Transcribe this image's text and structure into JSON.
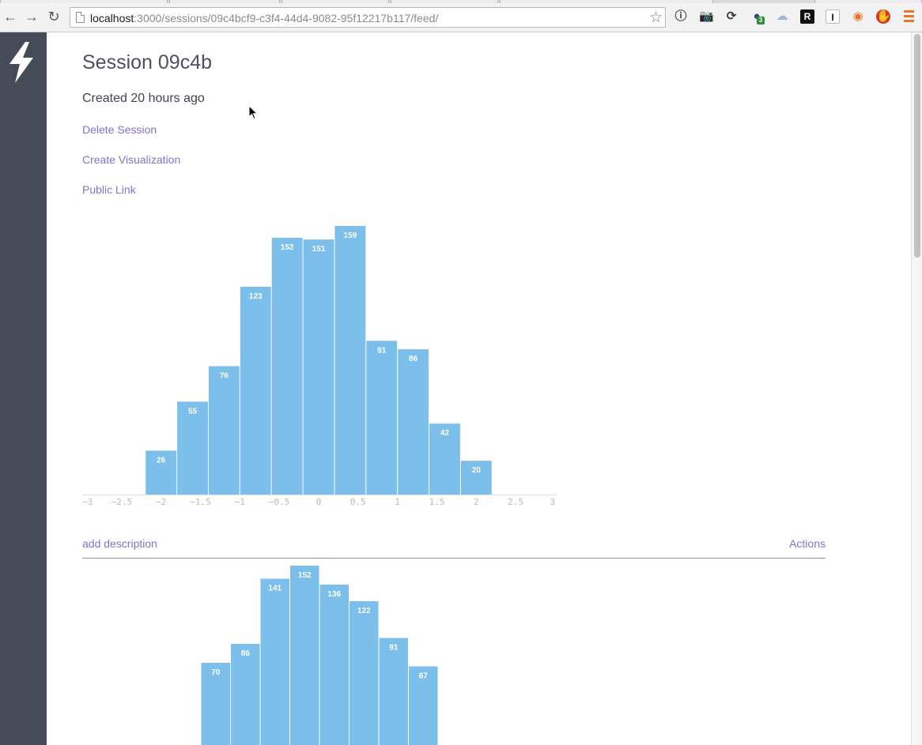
{
  "browser": {
    "url_host": "localhost",
    "url_rest": ":3000/sessions/09c4bcf9-c3f4-44d4-9082-95f12217b117/feed/",
    "extensions": [
      {
        "name": "info-extension-icon",
        "glyph": "ⓘ",
        "color": "#444444",
        "bg": "transparent"
      },
      {
        "name": "camera-extension-icon",
        "glyph": "📷",
        "color": "#8fb3d6",
        "bg": "transparent"
      },
      {
        "name": "sync-extension-icon",
        "glyph": "⟳",
        "color": "#333333",
        "bg": "transparent"
      },
      {
        "name": "badge-extension-icon",
        "glyph": "●",
        "color": "#2c4c7c",
        "bg": "transparent",
        "badge": "3"
      },
      {
        "name": "cloud-extension-icon",
        "glyph": "☁",
        "color": "#9ab5d6",
        "bg": "transparent"
      },
      {
        "name": "r-extension-icon",
        "glyph": "R",
        "color": "#ffffff",
        "bg": "#111111"
      },
      {
        "name": "i-extension-icon",
        "glyph": "I",
        "color": "#111111",
        "bg": "#ffffff"
      },
      {
        "name": "color-extension-icon",
        "glyph": "◉",
        "color": "#e8742a",
        "bg": "transparent"
      },
      {
        "name": "stop-extension-icon",
        "glyph": "✋",
        "color": "#ffffff",
        "bg": "#d9332a"
      }
    ]
  },
  "session": {
    "title": "Session 09c4b",
    "created": "Created 20 hours ago",
    "links": {
      "delete": "Delete Session",
      "create_viz": "Create Visualization",
      "public": "Public Link"
    }
  },
  "viz1": {
    "add_description": "add description",
    "actions": "Actions"
  },
  "colors": {
    "bar": "#7bbfea",
    "link": "#7d76c9",
    "sidebar": "#454b57"
  },
  "chart_data": [
    {
      "type": "bar",
      "title": "",
      "xlabel": "",
      "ylabel": "",
      "xlim": [
        -3,
        3
      ],
      "xticks": [
        "-3",
        "-2.5",
        "-2",
        "-1.5",
        "-1",
        "-0.5",
        "0",
        "0.5",
        "1",
        "1.5",
        "2",
        "2.5",
        "3"
      ],
      "bin_edges": [
        -2.2,
        -1.8,
        -1.4,
        -1.0,
        -0.6,
        -0.2,
        0.2,
        0.6,
        1.0,
        1.4,
        1.8,
        2.2
      ],
      "values": [
        26,
        55,
        76,
        123,
        152,
        151,
        159,
        91,
        86,
        42,
        20
      ],
      "ylim": [
        0,
        159
      ],
      "grid": false
    },
    {
      "type": "bar",
      "title": "",
      "xlabel": "",
      "ylabel": "",
      "values": [
        70,
        86,
        141,
        152,
        136,
        122,
        91,
        67
      ],
      "grid": false
    }
  ]
}
